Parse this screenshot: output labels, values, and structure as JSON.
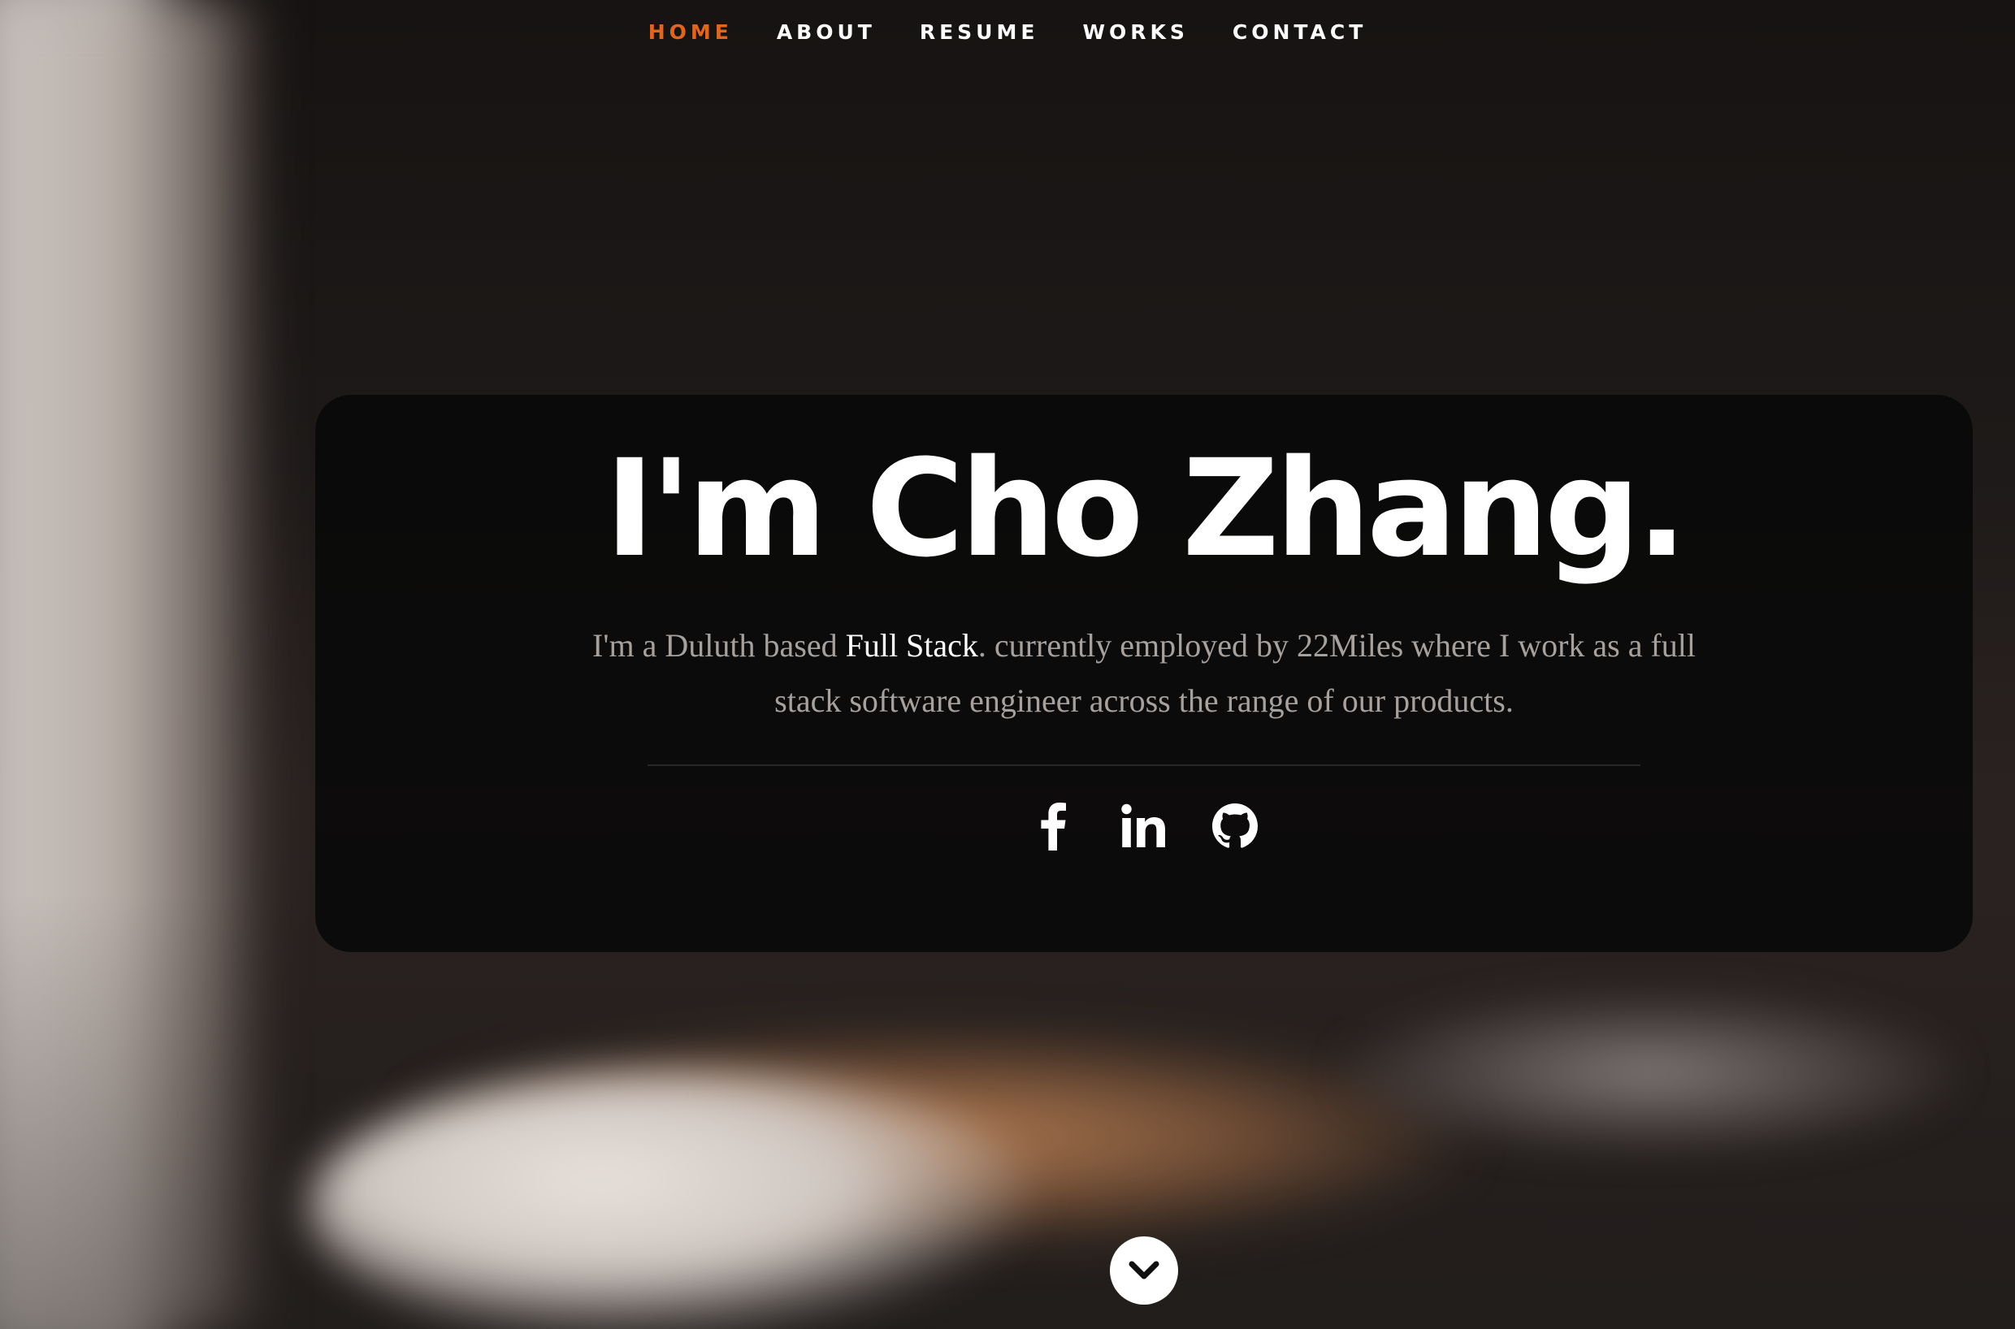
{
  "nav": {
    "items": [
      {
        "label": "HOME",
        "active": true
      },
      {
        "label": "ABOUT",
        "active": false
      },
      {
        "label": "RESUME",
        "active": false
      },
      {
        "label": "WORKS",
        "active": false
      },
      {
        "label": "CONTACT",
        "active": false
      }
    ],
    "active_color": "#e0661f"
  },
  "hero": {
    "title": "I'm Cho Zhang.",
    "text_before": "I'm a Duluth based ",
    "text_highlight": "Full Stack",
    "text_after": ". currently employed by 22Miles where I work as a full stack software engineer across the range of our products."
  },
  "social": [
    {
      "icon": "facebook-icon"
    },
    {
      "icon": "linkedin-icon"
    },
    {
      "icon": "github-icon"
    }
  ],
  "scroll": {
    "icon": "chevron-down-icon"
  }
}
